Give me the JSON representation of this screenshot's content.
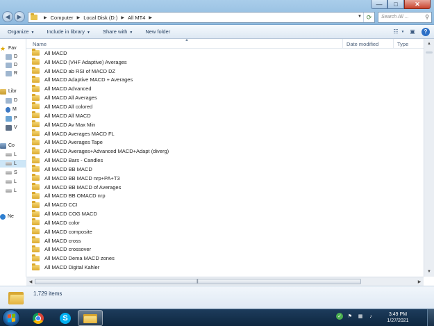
{
  "window": {
    "minimize": "—",
    "maximize": "□",
    "close": "✕"
  },
  "address": {
    "crumbs": [
      "Computer",
      "Local Disk (D:)",
      "All MT4"
    ],
    "search_placeholder": "Search All ..."
  },
  "toolbar": {
    "organize": "Organize",
    "include_in_library": "Include in library",
    "share_with": "Share with",
    "new_folder": "New folder",
    "help": "?"
  },
  "nav": {
    "items": [
      {
        "label": "Fav",
        "icon": "star-icon"
      },
      {
        "label": "D",
        "icon": "desktop-icon"
      },
      {
        "label": "D",
        "icon": "downloads-icon"
      },
      {
        "label": "R",
        "icon": "recent-places-icon"
      },
      {
        "label": "Libr",
        "icon": "libraries-icon"
      },
      {
        "label": "D",
        "icon": "documents-icon"
      },
      {
        "label": "M",
        "icon": "music-icon"
      },
      {
        "label": "P",
        "icon": "pictures-icon"
      },
      {
        "label": "V",
        "icon": "videos-icon"
      },
      {
        "label": "Co",
        "icon": "computer-icon"
      },
      {
        "label": "L",
        "icon": "drive-icon"
      },
      {
        "label": "L",
        "icon": "drive-icon"
      },
      {
        "label": "S",
        "icon": "drive-icon"
      },
      {
        "label": "L",
        "icon": "drive-icon"
      },
      {
        "label": "L",
        "icon": "drive-icon"
      },
      {
        "label": "Ne",
        "icon": "network-icon"
      }
    ]
  },
  "columns": {
    "name": "Name",
    "date_modified": "Date modified",
    "type": "Type"
  },
  "files": [
    "All  MACD",
    "All  MACD (VHF Adaptive) Averages",
    "All  MACD ab RSI of MACD DZ",
    "All  MACD Adaptive MACD + Averages",
    "All  MACD Advanced",
    "All  MACD All Averages",
    "All  MACD All colored",
    "All  MACD All MACD",
    "All  MACD Av Max Min",
    "All  MACD Averages MACD FL",
    "All  MACD Averages Tape",
    "All  MACD Averages+Advanced MACD+Adapt (diverg)",
    "All  MACD Bars - Candles",
    "All  MACD BB MACD",
    "All  MACD BB MACD nrp+PA+T3",
    "All  MACD BB MACD of Averages",
    "All  MACD BB OMACD nrp",
    "All  MACD CCI",
    "All  MACD COG MACD",
    "All  MACD color",
    "All  MACD composite",
    "All  MACD cross",
    "All  MACD crossover",
    "All  MACD Dema MACD zones",
    "All  MACD Digital Kahler"
  ],
  "status": {
    "item_count": "1,729 items"
  },
  "taskbar": {
    "time": "3:49 PM",
    "date": "1/27/2021"
  }
}
